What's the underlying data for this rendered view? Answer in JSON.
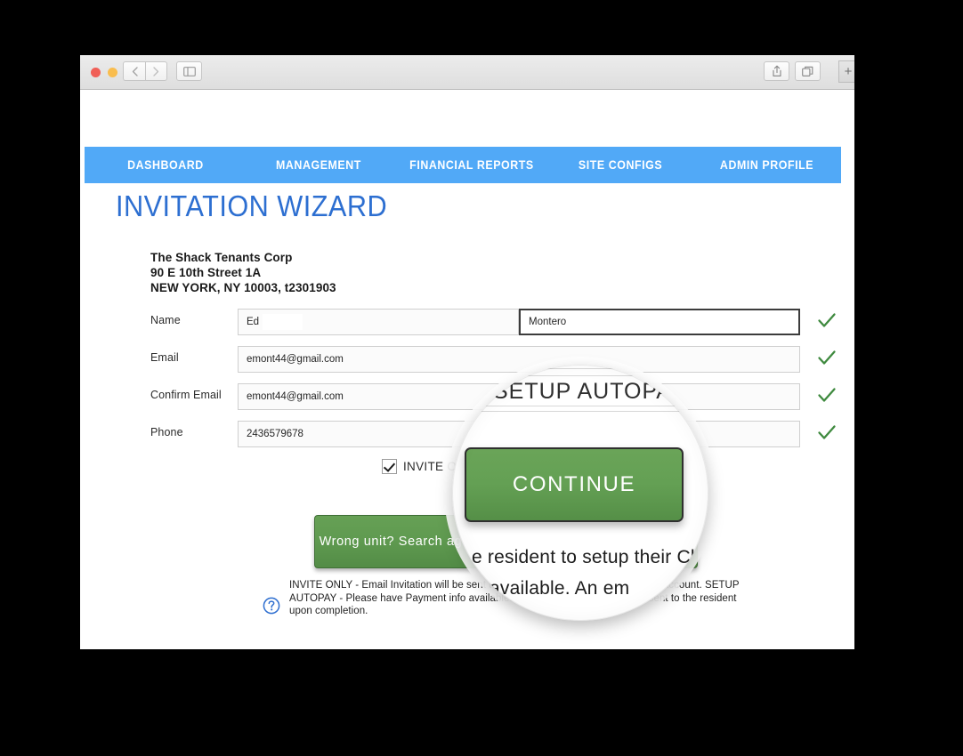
{
  "browser": {
    "controls": {
      "close": "close-window",
      "minimize": "minimize-window",
      "maximize": "maximize-window",
      "back": "‹",
      "forward": "›",
      "sidebar": "▥",
      "share": "⇧",
      "tabs": "❐",
      "new_tab": "+"
    }
  },
  "nav": {
    "items": [
      {
        "label": "DASHBOARD"
      },
      {
        "label": "MANAGEMENT"
      },
      {
        "label": "FINANCIAL REPORTS"
      },
      {
        "label": "SITE CONFIGS"
      },
      {
        "label": "ADMIN PROFILE"
      }
    ]
  },
  "page": {
    "title": "INVITATION WIZARD",
    "accent_blue": "#2d6fd1",
    "nav_blue": "#51a9f7",
    "button_green": "#5f9a50",
    "check_green": "#3f8a3f"
  },
  "property": {
    "name": "The Shack Tenants Corp",
    "street": "90 E 10th Street 1A",
    "city_line": "NEW YORK, NY 10003, t2301903"
  },
  "form": {
    "rows": [
      {
        "label": "Name",
        "first_value": "Ed",
        "last_value": "Montero",
        "valid_icon": "check-icon"
      },
      {
        "label": "Email",
        "value": "emont44@gmail.com",
        "valid_icon": "check-icon"
      },
      {
        "label": "Confirm Email",
        "value": "emont44@gmail.com",
        "valid_icon": "check-icon"
      },
      {
        "label": "Phone",
        "value": "2436579678",
        "valid_icon": "check-icon"
      }
    ]
  },
  "options": {
    "invite_only": {
      "label": "INVITE ONLY",
      "checked": true
    },
    "setup_autopay": {
      "label": "SETUP AUTOPAY",
      "checked": false
    }
  },
  "buttons": {
    "search_again": "Wrong unit? Search again...",
    "continue": "CONTINUE"
  },
  "help": {
    "icon": "question-circle-icon",
    "text": "INVITE ONLY - Email Invitation will be sent to the resident to setup their ClickPay account. SETUP AUTOPAY - Please have Payment info available. An email confirmation will be sent to the resident upon completion."
  },
  "magnifier": {
    "autopay_label": "SETUP AUTOPAY",
    "continue_label": "CONTINUE",
    "help_line_1": "e resident to setup their Click",
    "help_line_2": "available. An em"
  }
}
